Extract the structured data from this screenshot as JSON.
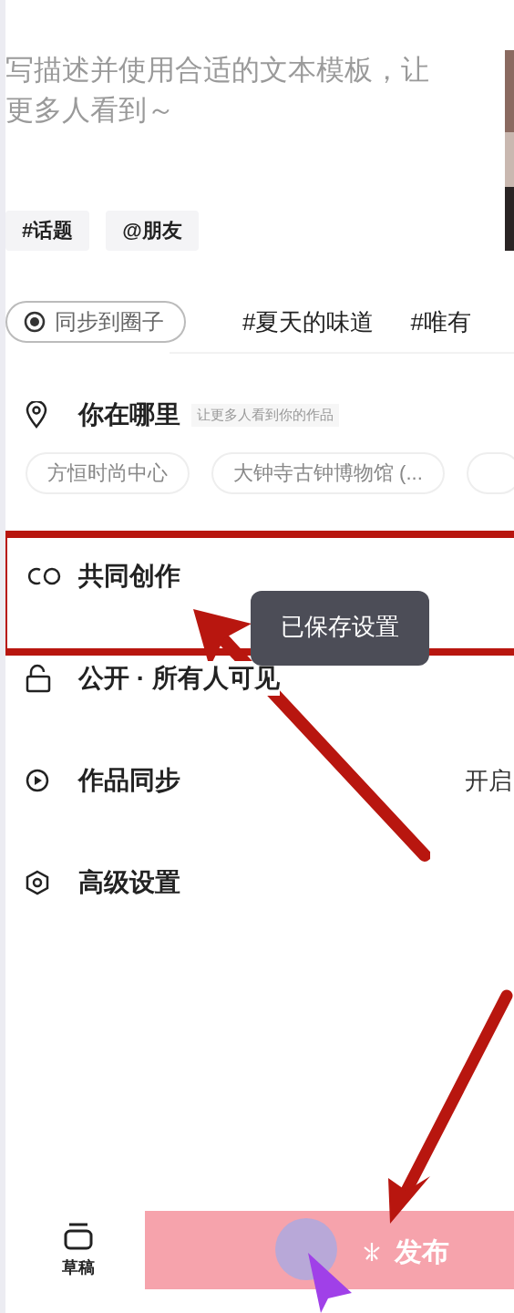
{
  "description": {
    "placeholder": "写描述并使用合适的文本模板，让更多人看到～"
  },
  "tags": [
    "#话题",
    "@朋友"
  ],
  "sync_circle": {
    "label": "同步到圈子"
  },
  "hashtags": [
    "#夏天的味道",
    "#唯有"
  ],
  "location": {
    "title": "你在哪里",
    "hint": "让更多人看到你的作品",
    "chips": [
      "方恒时尚中心",
      "大钟寺古钟博物馆 (..."
    ]
  },
  "settings": [
    {
      "kind": "cocreate",
      "label": "共同创作"
    },
    {
      "kind": "privacy",
      "label": "公开 · 所有人可见"
    },
    {
      "kind": "sync",
      "label": "作品同步",
      "value": "开启"
    },
    {
      "kind": "advanced",
      "label": "高级设置"
    }
  ],
  "toast": "已保存设置",
  "bottom": {
    "drafts": "草稿",
    "publish": "发布"
  }
}
